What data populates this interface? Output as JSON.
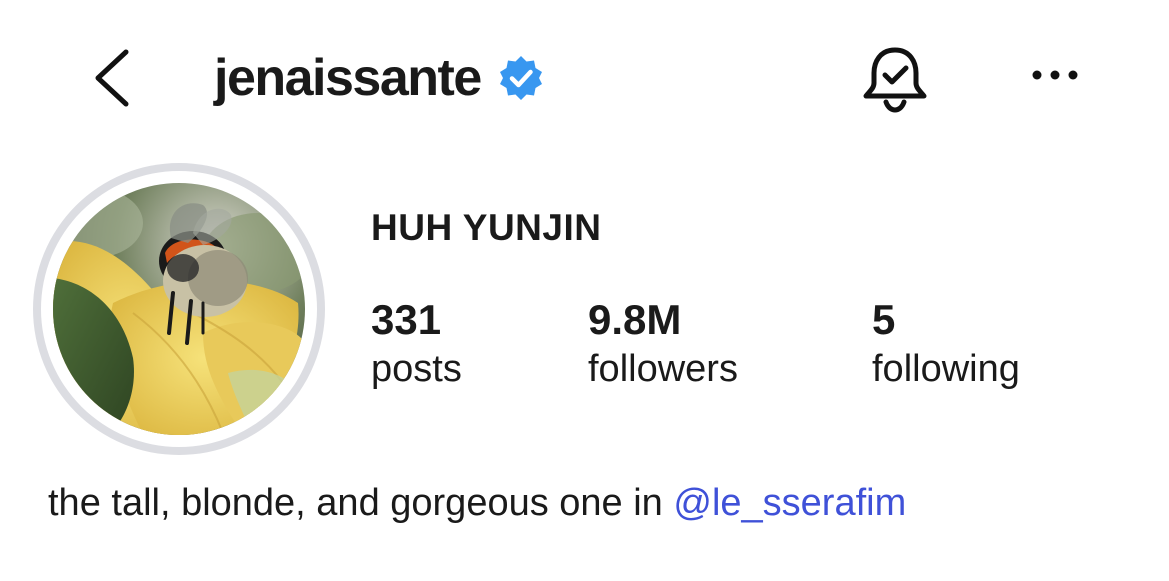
{
  "header": {
    "username": "jenaissante",
    "verified": true
  },
  "profile": {
    "display_name": "HUH YUNJIN",
    "stats": [
      {
        "count": "331",
        "label": "posts"
      },
      {
        "count": "9.8M",
        "label": "followers"
      },
      {
        "count": "5",
        "label": "following"
      }
    ],
    "bio": {
      "text": "the tall, blonde, and gorgeous one in ",
      "mention": "@le_sserafim"
    }
  },
  "icons": {
    "back": "chevron-left-icon",
    "verified": "verified-badge-icon",
    "notifications": "bell-check-icon",
    "more": "more-horizontal-icon"
  },
  "colors": {
    "verified_blue": "#3897f0",
    "mention_blue": "#3f51d8",
    "avatar_ring": "#dcdde2"
  }
}
